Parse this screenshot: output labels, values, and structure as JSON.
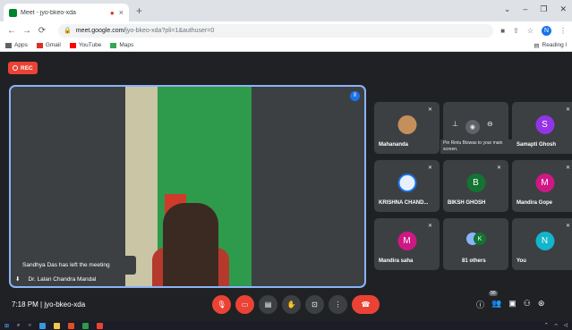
{
  "browser": {
    "tab_title": "Meet - jyo-bkeo-xda",
    "tab_rec_icon": "record-dot-icon",
    "tab_close": "×",
    "new_tab": "+",
    "window_controls": [
      "⌄",
      "–",
      "❐",
      "✕"
    ],
    "url_host": "meet.google.com/",
    "url_path": "jyo-bkeo-xda?pli=1&authuser=0",
    "profile_initial": "N",
    "bookmarks": [
      {
        "label": "Apps",
        "color": "#5f6368"
      },
      {
        "label": "Gmail",
        "color": "#d93025"
      },
      {
        "label": "YouTube",
        "color": "#ff0000"
      },
      {
        "label": "Maps",
        "color": "#34a853"
      }
    ],
    "reading_list": "Reading l"
  },
  "meeting": {
    "rec_label": "REC",
    "main_speaker": "Dr. Lalan Chandra Mandal",
    "toast": "Sandhya Das has left the meeting",
    "time": "7:18 PM",
    "separator": "|",
    "code": "jyo-bkeo-xda",
    "tooltip": "Pin Rintu Biswas to your main screen.",
    "participant_count": "90"
  },
  "tiles": [
    {
      "name": "Mahananda",
      "avatar": "",
      "color": "#c58f5b"
    },
    {
      "name": "",
      "avatar": "",
      "color": ""
    },
    {
      "name": "Samapti Ghosh",
      "avatar": "S",
      "color": "#9334e6"
    },
    {
      "name": "KRISHNA CHAND...",
      "avatar": "",
      "color": "#e8f0fe"
    },
    {
      "name": "BIKSH GHOSH",
      "avatar": "B",
      "color": "#137333"
    },
    {
      "name": "Mandira Gope",
      "avatar": "M",
      "color": "#d01884"
    },
    {
      "name": "Mandira saha",
      "avatar": "M",
      "color": "#d01884"
    },
    {
      "name": "81 others",
      "avatar": "K",
      "color": "#137333"
    },
    {
      "name": "You",
      "avatar": "N",
      "color": "#12b5cb"
    }
  ],
  "colors": {
    "accent": "#8ab4f8",
    "danger": "#ea4335",
    "tile_bg": "#3c4043",
    "bg": "#202124"
  }
}
